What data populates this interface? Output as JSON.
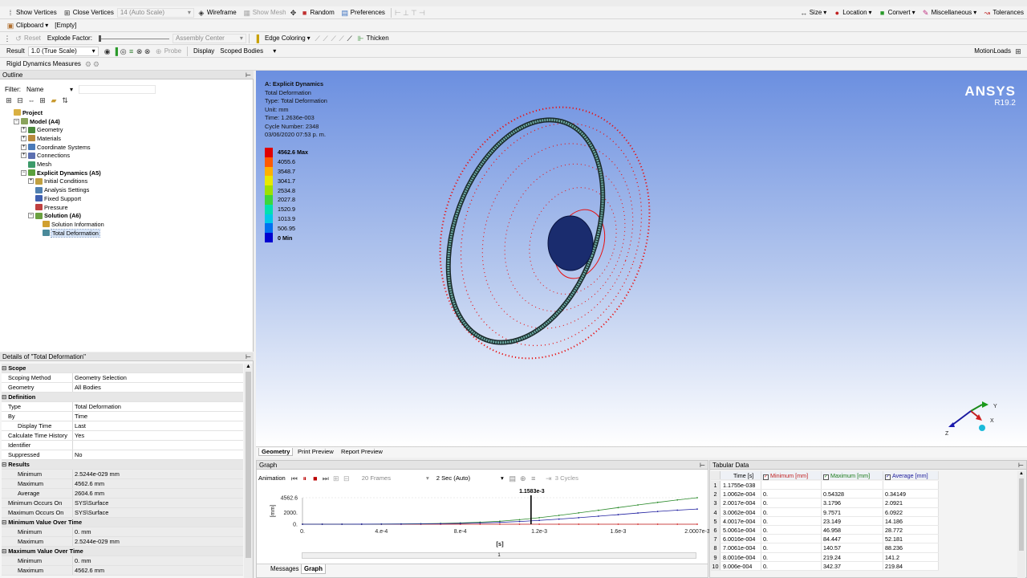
{
  "toolbar1": {
    "show_vertices": "Show Vertices",
    "close_vertices": "Close Vertices",
    "auto_scale": "14 (Auto Scale)",
    "wireframe": "Wireframe",
    "show_mesh": "Show Mesh",
    "random": "Random",
    "preferences": "Preferences",
    "size": "Size",
    "location": "Location",
    "convert": "Convert",
    "miscellaneous": "Miscellaneous",
    "tolerances": "Tolerances"
  },
  "toolbar2": {
    "clipboard": "Clipboard",
    "clipboard_value": "[Empty]"
  },
  "toolbar3": {
    "reset": "Reset",
    "explode_factor": "Explode Factor:",
    "assembly_center": "Assembly Center",
    "edge_coloring": "Edge Coloring",
    "thicken": "Thicken"
  },
  "toolbar4": {
    "result": "Result",
    "scale": "1.0 (True Scale)",
    "probe": "Probe",
    "display": "Display",
    "scoped_bodies": "Scoped Bodies",
    "motion_loads": "MotionLoads"
  },
  "toolbar5": {
    "rigid_dynamics": "Rigid Dynamics Measures"
  },
  "outline": {
    "title": "Outline",
    "filter_label": "Filter:",
    "filter_value": "Name",
    "items": [
      {
        "label": "Project",
        "depth": 0,
        "bold": true,
        "exp": "",
        "color": "#d9b042"
      },
      {
        "label": "Model (A4)",
        "depth": 1,
        "bold": true,
        "exp": "−",
        "color": "#8aa35c"
      },
      {
        "label": "Geometry",
        "depth": 2,
        "bold": false,
        "exp": "+",
        "color": "#4a8a3c"
      },
      {
        "label": "Materials",
        "depth": 2,
        "bold": false,
        "exp": "+",
        "color": "#b88a3c"
      },
      {
        "label": "Coordinate Systems",
        "depth": 2,
        "bold": false,
        "exp": "+",
        "color": "#4a7ab8"
      },
      {
        "label": "Connections",
        "depth": 2,
        "bold": false,
        "exp": "+",
        "color": "#5c6fb0"
      },
      {
        "label": "Mesh",
        "depth": 2,
        "bold": false,
        "exp": "",
        "color": "#3c9a6a"
      },
      {
        "label": "Explicit Dynamics (A5)",
        "depth": 2,
        "bold": true,
        "exp": "−",
        "color": "#5aa03c"
      },
      {
        "label": "Initial Conditions",
        "depth": 3,
        "bold": false,
        "exp": "+",
        "color": "#c0a040"
      },
      {
        "label": "Analysis Settings",
        "depth": 3,
        "bold": false,
        "exp": "",
        "color": "#5080b0"
      },
      {
        "label": "Fixed Support",
        "depth": 3,
        "bold": false,
        "exp": "",
        "color": "#4060b0"
      },
      {
        "label": "Pressure",
        "depth": 3,
        "bold": false,
        "exp": "",
        "color": "#c04040"
      },
      {
        "label": "Solution (A6)",
        "depth": 3,
        "bold": true,
        "exp": "−",
        "color": "#6aa040"
      },
      {
        "label": "Solution Information",
        "depth": 4,
        "bold": false,
        "exp": "",
        "color": "#d0a030"
      },
      {
        "label": "Total Deformation",
        "depth": 4,
        "bold": false,
        "exp": "",
        "color": "#4a8a9a",
        "selected": true
      }
    ]
  },
  "details": {
    "title": "Details of \"Total Deformation\"",
    "rows": [
      {
        "type": "sec",
        "k": "Scope",
        "v": ""
      },
      {
        "type": "row",
        "k": "Scoping Method",
        "v": "Geometry Selection"
      },
      {
        "type": "row",
        "k": "Geometry",
        "v": "All Bodies"
      },
      {
        "type": "sec",
        "k": "Definition",
        "v": ""
      },
      {
        "type": "row",
        "k": "Type",
        "v": "Total Deformation"
      },
      {
        "type": "row",
        "k": "By",
        "v": "Time"
      },
      {
        "type": "ind",
        "k": "Display Time",
        "v": "Last"
      },
      {
        "type": "row",
        "k": "Calculate Time History",
        "v": "Yes"
      },
      {
        "type": "row",
        "k": "Identifier",
        "v": ""
      },
      {
        "type": "row",
        "k": "Suppressed",
        "v": "No"
      },
      {
        "type": "sec",
        "k": "Results",
        "v": ""
      },
      {
        "type": "ind gr",
        "k": "Minimum",
        "v": "2.5244e-029 mm"
      },
      {
        "type": "ind gr",
        "k": "Maximum",
        "v": "4562.6 mm"
      },
      {
        "type": "ind gr",
        "k": "Average",
        "v": "2604.6 mm"
      },
      {
        "type": "gr",
        "k": "Minimum Occurs On",
        "v": "SYS\\Surface"
      },
      {
        "type": "gr",
        "k": "Maximum Occurs On",
        "v": "SYS\\Surface"
      },
      {
        "type": "sec",
        "k": "Minimum Value Over Time",
        "v": ""
      },
      {
        "type": "ind gr",
        "k": "Minimum",
        "v": "0. mm"
      },
      {
        "type": "ind gr",
        "k": "Maximum",
        "v": "2.5244e-029 mm"
      },
      {
        "type": "sec",
        "k": "Maximum Value Over Time",
        "v": ""
      },
      {
        "type": "ind gr",
        "k": "Minimum",
        "v": "0. mm"
      },
      {
        "type": "ind gr",
        "k": "Maximum",
        "v": "4562.6 mm"
      }
    ]
  },
  "viewport": {
    "info": [
      "A: Explicit Dynamics",
      "Total Deformation",
      "Type: Total Deformation",
      "Unit: mm",
      "Time: 1.2636e-003",
      "Cycle Number: 2348",
      "03/06/2020 07:53 p. m."
    ],
    "legend": [
      {
        "label": "4562.6 Max",
        "color": "#e00000"
      },
      {
        "label": "4055.6",
        "color": "#ff5a00"
      },
      {
        "label": "3548.7",
        "color": "#ffb000"
      },
      {
        "label": "3041.7",
        "color": "#e8e800"
      },
      {
        "label": "2534.8",
        "color": "#9ee000"
      },
      {
        "label": "2027.8",
        "color": "#3cd63c"
      },
      {
        "label": "1520.9",
        "color": "#00e0b0"
      },
      {
        "label": "1013.9",
        "color": "#00c8e8"
      },
      {
        "label": "506.95",
        "color": "#0070f0"
      },
      {
        "label": "0 Min",
        "color": "#0000d0"
      }
    ],
    "brand": "ANSYS",
    "version": "R19.2",
    "triad_x": "X",
    "triad_y": "Y",
    "triad_z": "Z"
  },
  "viewtabs": [
    "Geometry",
    "Print Preview",
    "Report Preview"
  ],
  "graph": {
    "title": "Graph",
    "animation": "Animation",
    "frames": "20 Frames",
    "duration": "2 Sec (Auto)",
    "cycles": "3 Cycles",
    "marker": "1.1583e-3",
    "slider_label": "1",
    "ylabel": "[mm]",
    "xlabel": "[s]",
    "yticks": [
      "4562.6",
      "2000.",
      "0."
    ],
    "xticks": [
      "0.",
      "4.e-4",
      "8.e-4",
      "1.2e-3",
      "1.6e-3",
      "2.0007e-3"
    ]
  },
  "bottomtabs": [
    "Messages",
    "Graph"
  ],
  "tabular": {
    "title": "Tabular Data",
    "headers": [
      "Time [s]",
      "Minimum [mm]",
      "Maximum [mm]",
      "Average [mm]"
    ],
    "rows": [
      [
        "1",
        "1.1755e-038",
        "",
        "",
        ""
      ],
      [
        "2",
        "1.0062e-004",
        "0.",
        "0.54328",
        "0.34149"
      ],
      [
        "3",
        "2.0017e-004",
        "0.",
        "3.1796",
        "2.0921"
      ],
      [
        "4",
        "3.0062e-004",
        "0.",
        "9.7571",
        "6.0922"
      ],
      [
        "5",
        "4.0017e-004",
        "0.",
        "23.149",
        "14.186"
      ],
      [
        "6",
        "5.0061e-004",
        "0.",
        "46.958",
        "28.772"
      ],
      [
        "7",
        "6.0016e-004",
        "0.",
        "84.447",
        "52.181"
      ],
      [
        "8",
        "7.0061e-004",
        "0.",
        "140.57",
        "88.236"
      ],
      [
        "9",
        "8.0016e-004",
        "0.",
        "219.24",
        "141.2"
      ],
      [
        "10",
        "9.006e-004",
        "0.",
        "342.37",
        "219.84"
      ]
    ]
  },
  "chart_data": {
    "type": "line",
    "x": [
      0,
      0.0001,
      0.0002,
      0.0003,
      0.0004,
      0.0005,
      0.0006,
      0.0007,
      0.0008,
      0.0009,
      0.001,
      0.0011,
      0.0012,
      0.0013,
      0.0014,
      0.0015,
      0.0016,
      0.0017,
      0.0018,
      0.0019,
      0.0020007
    ],
    "series": [
      {
        "name": "Minimum [mm]",
        "color": "#d02020",
        "values": [
          0,
          0,
          0,
          0,
          0,
          0,
          0,
          0,
          0,
          0,
          0,
          0,
          0,
          0,
          0,
          0,
          0,
          0,
          0,
          0,
          0
        ]
      },
      {
        "name": "Maximum [mm]",
        "color": "#2a8a2a",
        "values": [
          0,
          0.5,
          3.2,
          9.8,
          23,
          47,
          84,
          141,
          219,
          342,
          520,
          780,
          1120,
          1520,
          1950,
          2400,
          2860,
          3320,
          3760,
          4180,
          4562.6
        ]
      },
      {
        "name": "Average [mm]",
        "color": "#2020a0",
        "values": [
          0,
          0.3,
          2.1,
          6.1,
          14,
          29,
          52,
          88,
          141,
          220,
          320,
          470,
          660,
          880,
          1120,
          1380,
          1650,
          1930,
          2200,
          2420,
          2604.6
        ]
      }
    ],
    "xlabel": "[s]",
    "ylabel": "[mm]",
    "xlim": [
      0,
      0.0020007
    ],
    "ylim": [
      0,
      4562.6
    ],
    "marker_x": 0.0011583
  }
}
